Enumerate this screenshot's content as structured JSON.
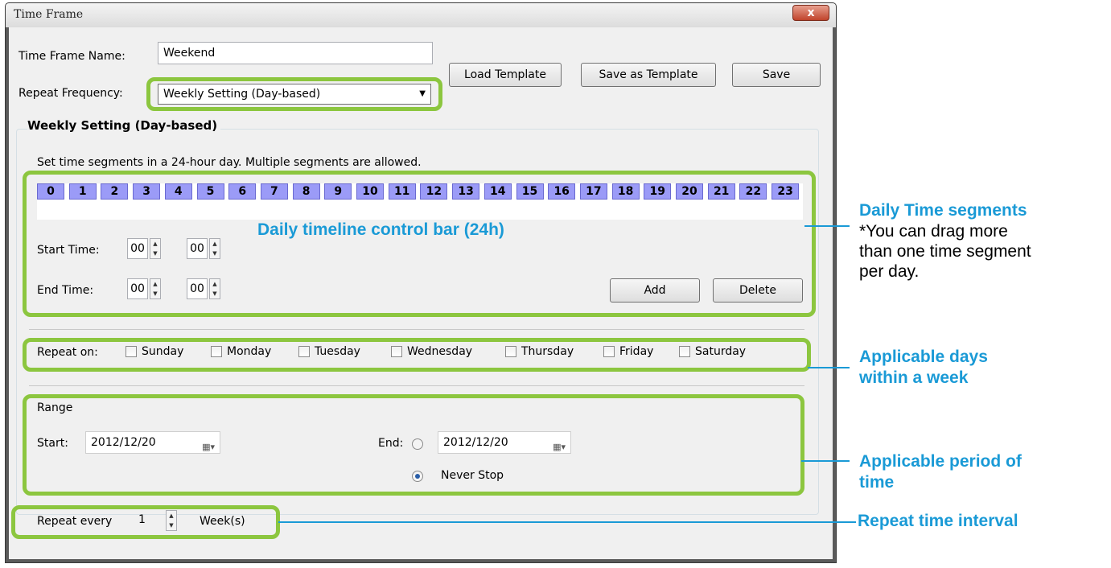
{
  "window": {
    "title": "Time Frame",
    "close_glyph": "x"
  },
  "form": {
    "name_label": "Time Frame Name:",
    "name_value": "Weekend",
    "repeat_label": "Repeat Frequency:",
    "repeat_value": "Weekly Setting (Day-based)",
    "load_label": "Load Template",
    "save_template_label": "Save as Template",
    "save_label": "Save"
  },
  "weekly": {
    "heading": "Weekly Setting (Day-based)",
    "instruction": "Set time segments in a 24-hour day. Multiple segments are allowed.",
    "hours": [
      "0",
      "1",
      "2",
      "3",
      "4",
      "5",
      "6",
      "7",
      "8",
      "9",
      "10",
      "11",
      "12",
      "13",
      "14",
      "15",
      "16",
      "17",
      "18",
      "19",
      "20",
      "21",
      "22",
      "23"
    ],
    "bar_label": "Daily timeline control bar (24h)",
    "start_label": "Start Time:",
    "start_hour": "00",
    "start_min": "00",
    "end_label": "End Time:",
    "end_hour": "00",
    "end_min": "00",
    "add_label": "Add",
    "delete_label": "Delete"
  },
  "repeat_on": {
    "label": "Repeat on:",
    "days": [
      "Sunday",
      "Monday",
      "Tuesday",
      "Wednesday",
      "Thursday",
      "Friday",
      "Saturday"
    ]
  },
  "range": {
    "label": "Range",
    "start_label": "Start:",
    "start_date": "2012/12/20",
    "end_label": "End:",
    "end_date": "2012/12/20",
    "never_stop_label": "Never Stop"
  },
  "interval": {
    "prefix": "Repeat every",
    "value": "1",
    "suffix": "Week(s)"
  },
  "callouts": {
    "segments_title": "Daily Time segments",
    "segments_note_1": "*You can drag more",
    "segments_note_2": "than one time segment",
    "segments_note_3": "per day.",
    "days_1": "Applicable days",
    "days_2": "within a week",
    "period_1": "Applicable period of",
    "period_2": "time",
    "interval": "Repeat time interval"
  },
  "colors": {
    "highlight": "#8cc63f",
    "callout": "#1a9ad6",
    "hour_cell": "#9b9bf7"
  }
}
